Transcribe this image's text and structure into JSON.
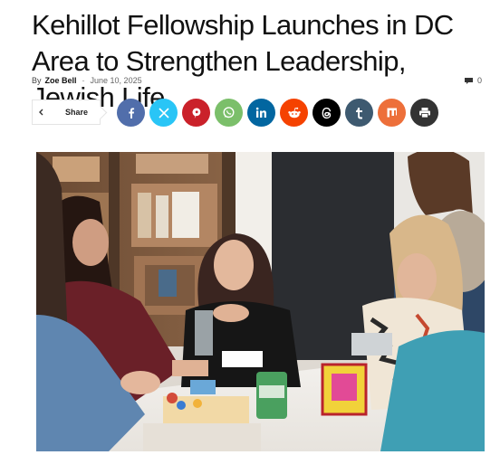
{
  "article": {
    "title": "Kehillot Fellowship Launches in DC Area to Strengthen Leadership, Jewish Life",
    "by_label": "By",
    "author": "Zoe Bell",
    "separator": "-",
    "date": "June 10, 2025",
    "comment_count": "0"
  },
  "share": {
    "label": "Share",
    "buttons": [
      {
        "name": "facebook-share-button",
        "icon": "facebook-icon",
        "color": "#516eab",
        "glyph": "f"
      },
      {
        "name": "x-share-button",
        "icon": "x-icon",
        "color": "#29c5f6",
        "glyph": "X"
      },
      {
        "name": "pinterest-share-button",
        "icon": "pinterest-icon",
        "color": "#ca212a",
        "glyph": "P"
      },
      {
        "name": "whatsapp-share-button",
        "icon": "whatsapp-icon",
        "color": "#7bbf6a",
        "glyph": "W"
      },
      {
        "name": "linkedin-share-button",
        "icon": "linkedin-icon",
        "color": "#0266a0",
        "glyph": "in"
      },
      {
        "name": "reddit-share-button",
        "icon": "reddit-icon",
        "color": "#f54200",
        "glyph": "R"
      },
      {
        "name": "threads-share-button",
        "icon": "threads-icon",
        "color": "#000000",
        "glyph": "@"
      },
      {
        "name": "tumblr-share-button",
        "icon": "tumblr-icon",
        "color": "#3e5a70",
        "glyph": "t"
      },
      {
        "name": "mix-share-button",
        "icon": "mix-icon",
        "color": "#ed6f3a",
        "glyph": "m"
      },
      {
        "name": "print-button",
        "icon": "print-icon",
        "color": "#333333",
        "glyph": "P"
      }
    ]
  },
  "image": {
    "description_icon": "photo-workshop-icon"
  }
}
